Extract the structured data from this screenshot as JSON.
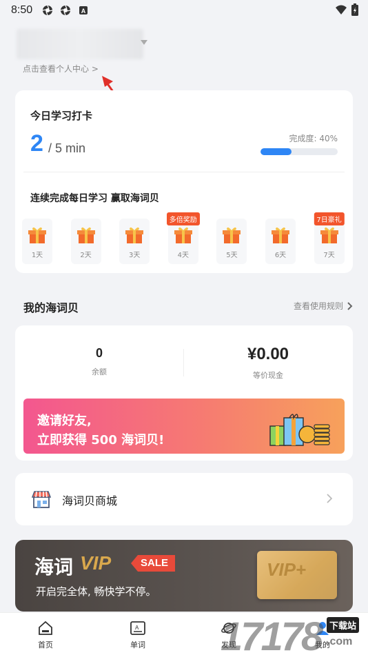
{
  "status_bar": {
    "time": "8:50",
    "icons": [
      "aperture-icon",
      "aperture-icon",
      "a-badge-icon"
    ],
    "right_icons": [
      "wifi-icon",
      "battery-icon"
    ]
  },
  "profile": {
    "link_text": "点击查看个人中心 >"
  },
  "checkin": {
    "title": "今日学习打卡",
    "minutes_done": "2",
    "minutes_total": "/ 5 min",
    "completion_label": "完成度: 40%",
    "completion_fraction": 0.4,
    "streak_title": "连续完成每日学习 赢取海词贝",
    "days": [
      {
        "label": "1天",
        "badge": ""
      },
      {
        "label": "2天",
        "badge": ""
      },
      {
        "label": "3天",
        "badge": ""
      },
      {
        "label": "4天",
        "badge": "多倍奖励"
      },
      {
        "label": "5天",
        "badge": ""
      },
      {
        "label": "6天",
        "badge": ""
      },
      {
        "label": "7天",
        "badge": "7日豪礼"
      }
    ]
  },
  "wallet": {
    "section_title": "我的海词贝",
    "rules_link": "查看使用规则",
    "balance_value": "0",
    "balance_label": "余额",
    "cash_value": "¥0.00",
    "cash_label": "等价现金",
    "invite_line1": "邀请好友,",
    "invite_line2": "立即获得 500 海词贝!"
  },
  "mall": {
    "label": "海词贝商城"
  },
  "vip": {
    "title": "海词",
    "vip_word": "VIP",
    "sale": "SALE",
    "subtitle": "开启完全体, 畅快学不停。",
    "card_text": "VIP+"
  },
  "nav": {
    "home": "首页",
    "words": "单词",
    "discover": "发现",
    "me": "我的"
  },
  "watermark": {
    "digits": "17178",
    "small": "下载站",
    "com": ".com"
  },
  "colors": {
    "accent": "#2e86f5",
    "badge_red": "#f2552c",
    "vip_gold": "#d9a84d"
  }
}
